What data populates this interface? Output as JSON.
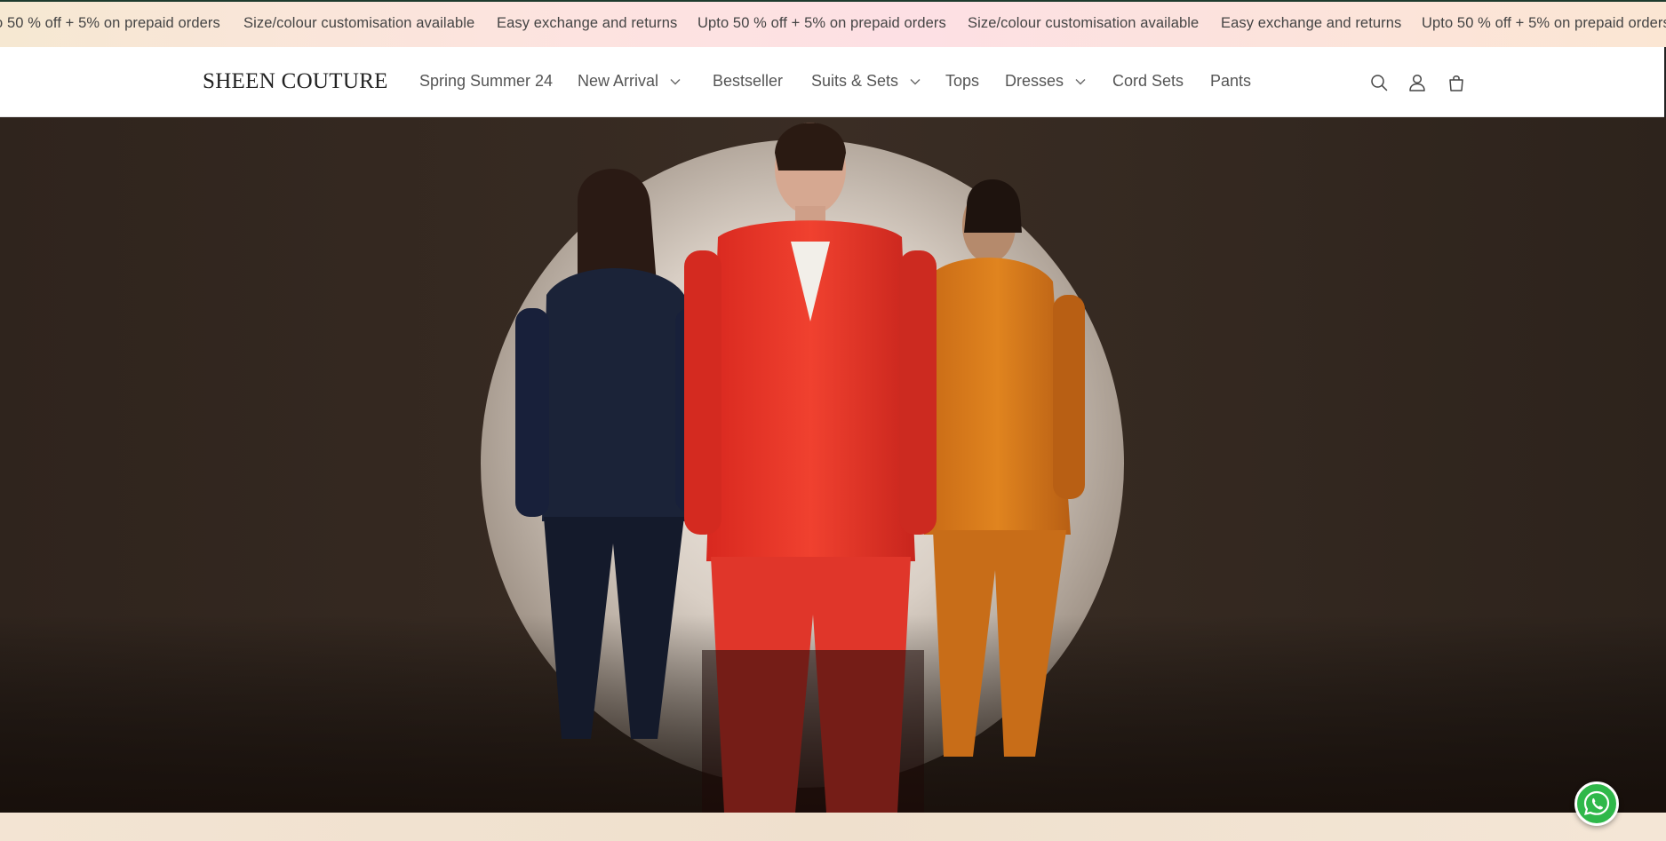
{
  "announcement": {
    "items": [
      "o 50 % off + 5% on prepaid orders",
      "Size/colour customisation available",
      "Easy exchange and returns",
      "Upto 50 % off + 5% on prepaid orders",
      "Size/colour customisation available",
      "Easy exchange and returns",
      "Upto 50 % off + 5% on prepaid orders"
    ]
  },
  "header": {
    "logo": "SHEEN COUTURE",
    "nav": [
      {
        "label": "Spring Summer 24",
        "has_dropdown": false
      },
      {
        "label": "New Arrival",
        "has_dropdown": true
      },
      {
        "label": "Bestseller",
        "has_dropdown": false
      },
      {
        "label": "Suits & Sets",
        "has_dropdown": true
      },
      {
        "label": "Tops",
        "has_dropdown": false
      },
      {
        "label": "Dresses",
        "has_dropdown": true
      },
      {
        "label": "Cord Sets",
        "has_dropdown": false
      },
      {
        "label": "Pants",
        "has_dropdown": false
      }
    ],
    "icons": [
      "search-icon",
      "account-icon",
      "cart-icon"
    ]
  },
  "hero": {
    "image": "three-models-in-pantsuits",
    "suit_colors": [
      "#1b2338",
      "#e8342a",
      "#d9781c"
    ]
  },
  "floating": {
    "icon": "whatsapp-icon",
    "color": "#2fb84a"
  }
}
